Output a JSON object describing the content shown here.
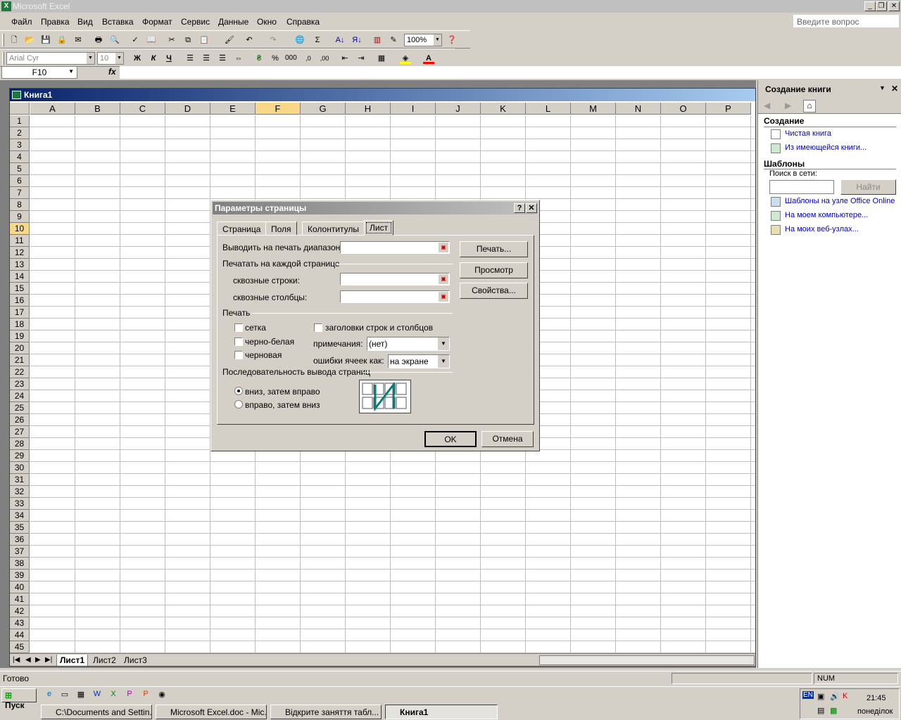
{
  "app": {
    "title": "Microsoft Excel"
  },
  "menu": [
    "Файл",
    "Правка",
    "Вид",
    "Вставка",
    "Формат",
    "Сервис",
    "Данные",
    "Окно",
    "Справка"
  ],
  "ask_placeholder": "Введите вопрос",
  "toolbar": {
    "zoom": "100%",
    "font": "Arial Cyr",
    "size": "10",
    "bold": "Ж",
    "italic": "К",
    "underline": "Ч",
    "percent": "%",
    "thousands": "000",
    "sum": "Σ"
  },
  "formula": {
    "cell": "F10",
    "fx": "fx",
    "value": ""
  },
  "workbook": {
    "title": "Книга1",
    "columns": [
      "A",
      "B",
      "C",
      "D",
      "E",
      "F",
      "G",
      "H",
      "I",
      "J",
      "K",
      "L",
      "M",
      "N",
      "O",
      "P"
    ],
    "rows": [
      "1",
      "2",
      "3",
      "4",
      "5",
      "6",
      "7",
      "8",
      "9",
      "10",
      "11",
      "12",
      "13",
      "14",
      "15",
      "16",
      "17",
      "18",
      "19",
      "20",
      "21",
      "22",
      "23",
      "24",
      "25",
      "26",
      "27",
      "28",
      "29",
      "30",
      "31",
      "32",
      "33",
      "34",
      "35",
      "36",
      "37",
      "38",
      "39",
      "40",
      "41",
      "42",
      "43",
      "44",
      "45"
    ],
    "sheets": [
      "Лист1",
      "Лист2",
      "Лист3"
    ],
    "active_cell": "F10"
  },
  "status": {
    "text": "Готово",
    "num": "NUM"
  },
  "taskpane": {
    "title": "Создание книги",
    "section_create": "Создание",
    "link_blank": "Чистая книга",
    "link_existing": "Из имеющейся книги...",
    "section_templates": "Шаблоны",
    "search_label": "Поиск в сети:",
    "search_button": "Найти",
    "link_online": "Шаблоны на узле Office Online",
    "link_computer": "На моем компьютере...",
    "link_web": "На моих веб-узлах..."
  },
  "dialog": {
    "title": "Параметры страницы",
    "help": "?",
    "close": "✕",
    "tabs": [
      "Страница",
      "Поля",
      "Колонтитулы",
      "Лист"
    ],
    "print_area_label": "Выводить на печать диапазон:",
    "print_titles_label": "Печатать на каждой странице",
    "rows_label": "сквозные строки:",
    "cols_label": "сквозные столбцы:",
    "print_group": "Печать",
    "gridlines": "сетка",
    "bw": "черно-белая",
    "draft": "черновая",
    "headings": "заголовки строк и столбцов",
    "comments_label": "примечания:",
    "comments_value": "(нет)",
    "errors_label": "ошибки ячеек как:",
    "errors_value": "на экране",
    "order_group": "Последовательность вывода страниц",
    "down_then_over": "вниз, затем вправо",
    "over_then_down": "вправо, затем вниз",
    "btn_print": "Печать...",
    "btn_preview": "Просмотр",
    "btn_props": "Свойства...",
    "ok": "OK",
    "cancel": "Отмена"
  },
  "taskbar": {
    "start": "Пуск",
    "tasks": [
      "C:\\Documents and Settin...",
      "Microsoft Excel.doc - Mic...",
      "Відкрите заняття табл...",
      "Книга1"
    ],
    "lang": "EN",
    "time": "21:45",
    "day": "понеділок"
  }
}
